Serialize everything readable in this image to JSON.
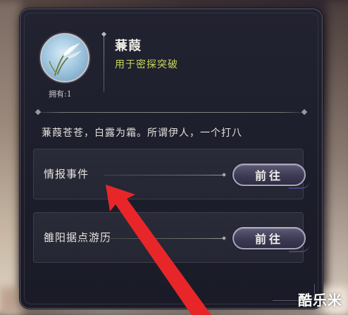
{
  "item": {
    "name": "蒹葭",
    "description": "用于密探突破",
    "owned": "拥有:1",
    "flavor_text": "蒹葭苍苍，白露为霜。所谓伊人，一个打八"
  },
  "sources": [
    {
      "label": "情报事件",
      "button": "前往"
    },
    {
      "label": "雒阳据点游历",
      "button": "前往"
    }
  ],
  "watermark": "酷乐米",
  "colors": {
    "panel_bg": "#1f202d",
    "desc_accent": "#c8d85a",
    "arrow_red": "#e8262a",
    "button_border": "#a9a4b8"
  },
  "icons": {
    "item_icon": "reed-plant-icon",
    "annotation": "red-arrow-icon"
  }
}
